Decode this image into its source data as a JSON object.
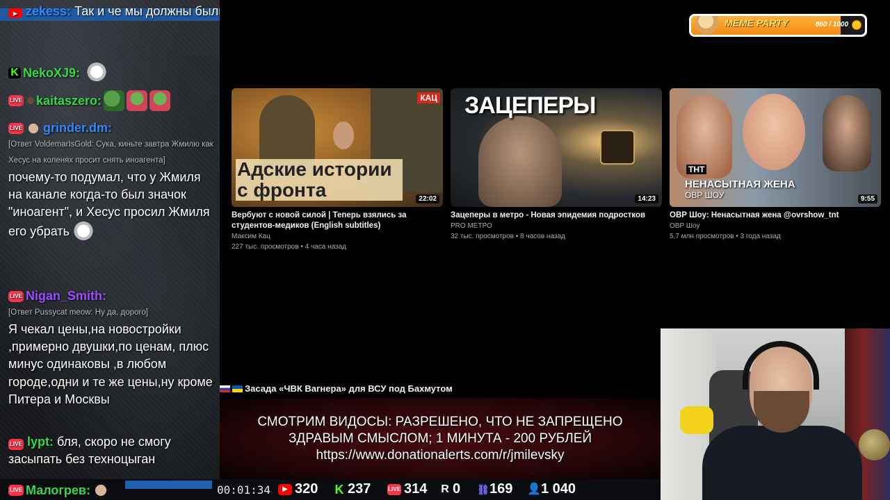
{
  "chat": {
    "messages": [
      {
        "platform": "youtube",
        "nick": "zekess:",
        "nick_color": "#2f8bff",
        "text": "Так и че мы должны были получить от видоса по мнению донатеру??"
      },
      {
        "platform": "kick",
        "nick": "NekoXJ9:",
        "nick_color": "#35d846",
        "text": ""
      },
      {
        "platform": "vk",
        "nick": "kaitaszero:",
        "nick_color": "#35d846",
        "text": ""
      },
      {
        "platform": "vk",
        "nick": "grinder.dm:",
        "nick_color": "#2f8bff",
        "reply": "[Ответ VoldemarIsGold: Сука, киньте завтра Жмилю как Хесус на коленях просит снять иноагента]",
        "text": "почему-то подумал, что у Жмиля на канале когда-то был значок \"иноагент\", и Хесус просил Жмиля его убрать"
      },
      {
        "platform": "vk",
        "nick": "Nigan_Smith:",
        "nick_color": "#9b4dff",
        "reply": "[Ответ Pussycat meow: Ну да, дорого]",
        "text": "Я чекал цены,на новостройки ,примерно двушки,по ценам, плюс минус одинаковы ,в любом городе,одни и те же цены,ну кроме Питера и Москвы"
      },
      {
        "platform": "vk",
        "nick": "lypt:",
        "nick_color": "#35d846",
        "text": "бля, скоро не смогу засыпать без техноцыган"
      }
    ],
    "last_nick": "Малогрев:"
  },
  "stats": {
    "timer": "00:01:34",
    "youtube": "320",
    "kick": "237",
    "vk": "314",
    "rutube": "0",
    "other": "169",
    "viewers": "1 040"
  },
  "videos": [
    {
      "title": "Вербуют с новой силой | Теперь взялись за студентов-медиков (English subtitles)",
      "channel": "Максим Кац",
      "meta": "227 тыс. просмотров • 4 часа назад",
      "duration": "22:02",
      "thumb_text": "Адские истории с фронта",
      "badge": "КАЦ"
    },
    {
      "title": "Зацеперы в метро - Новая эпидемия подростков",
      "channel": "PRO МЕТРО",
      "meta": "32 тыс. просмотров • 8 часов назад",
      "duration": "14:23",
      "thumb_text": "ЗАЦЕПЕРЫ"
    },
    {
      "title": "ОВР Шоу: Ненасытная жена @ovrshow_tnt",
      "channel": "ОВР Шоу",
      "meta": "5,7 млн просмотров • 3 года назад",
      "duration": "9:55",
      "thumb_text": "НЕНАСЫТНАЯ ЖЕНА",
      "thumb_sub": "ОВР ШОУ",
      "logo": "ТНТ"
    }
  ],
  "news": "Засада «ЧВК Вагнера» для ВСУ под Бахмутом",
  "banner": {
    "line1": "СМОТРИМ ВИДОСЫ: РАЗРЕШЕНО, ЧТО НЕ ЗАПРЕЩЕНО",
    "line2": "ЗДРАВЫМ СМЫСЛОМ; 1 МИНУТА - 200 РУБЛЕЙ",
    "line3": "https://www.donationalerts.com/r/jmilevsky"
  },
  "meme_party": {
    "title": "MEME PARTY",
    "count": "860 / 1000",
    "progress": 0.86
  }
}
